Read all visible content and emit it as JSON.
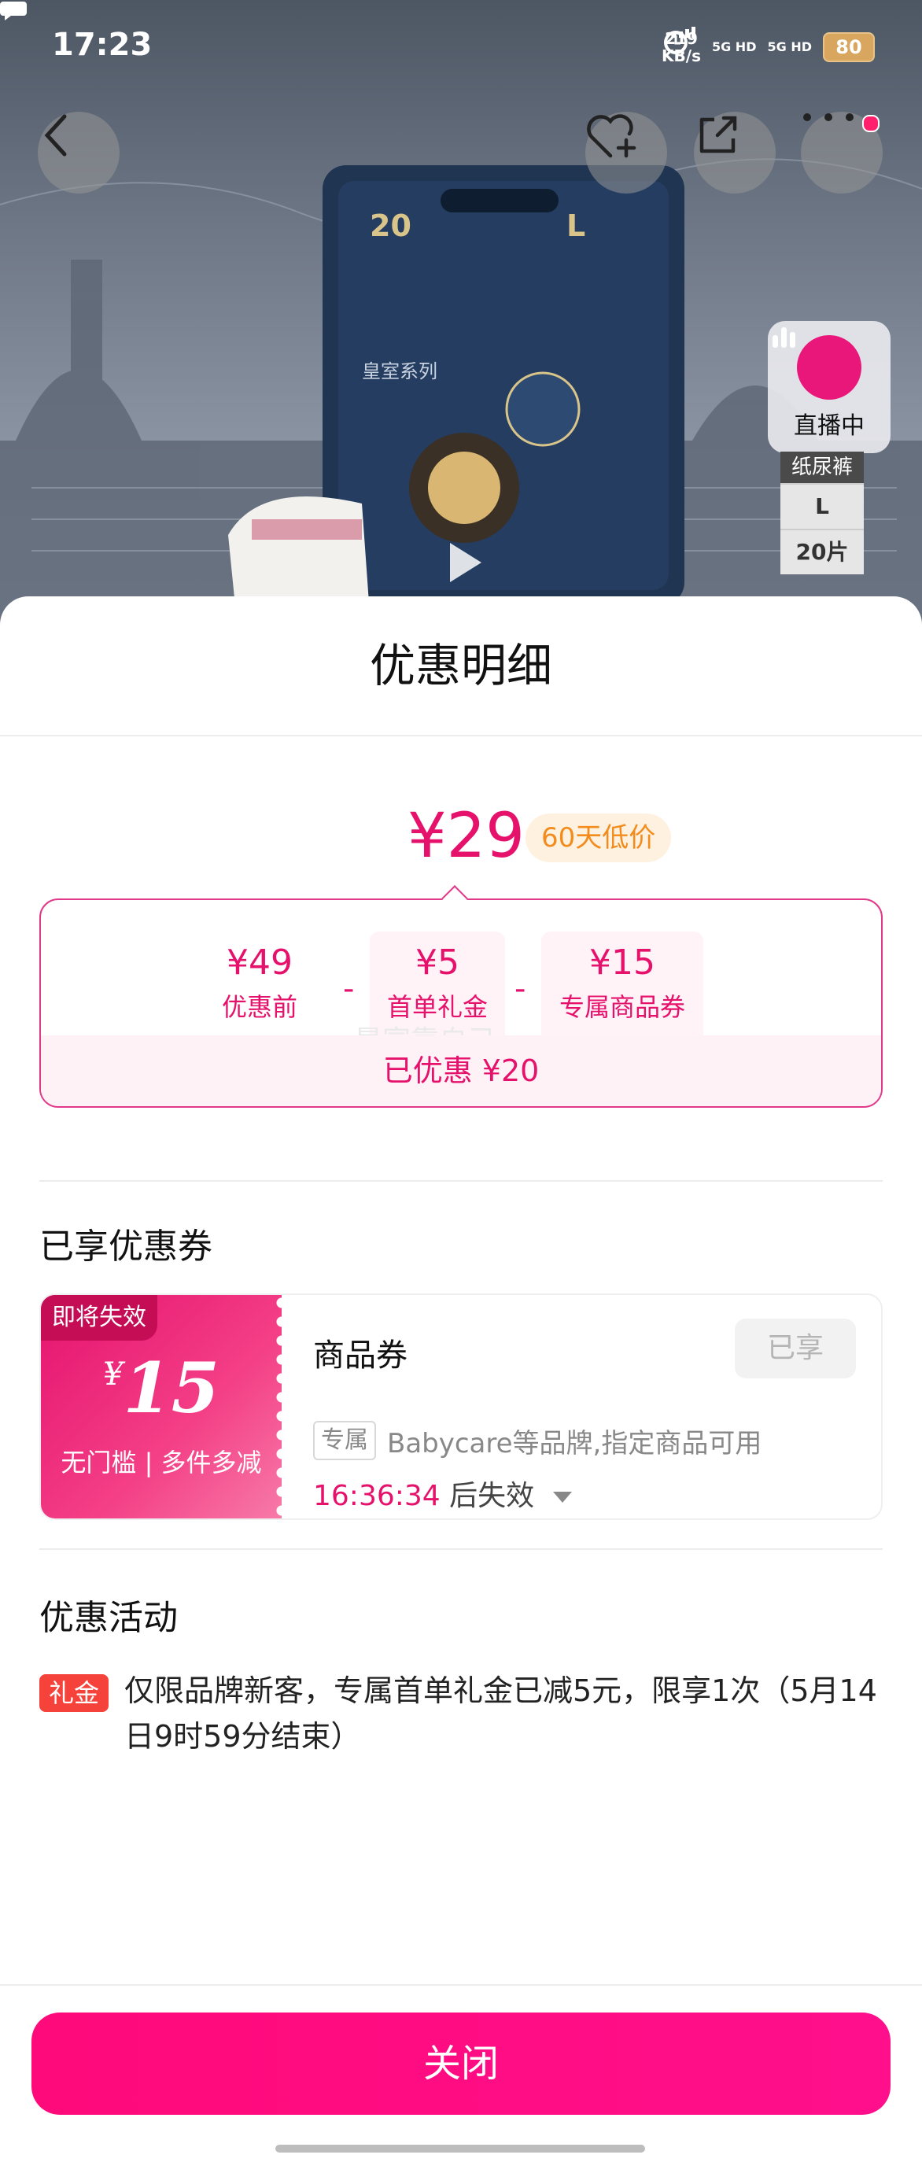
{
  "status_bar": {
    "time": "17:23",
    "net_speed_value": "219",
    "net_speed_unit": "KB/s",
    "network_1": "5G HD",
    "network_2": "5G HD",
    "battery": "80"
  },
  "product_overlay": {
    "live_label": "直播中",
    "spec_title": "纸尿裤",
    "spec_size": "L",
    "spec_count": "20片"
  },
  "sheet": {
    "title": "优惠明细",
    "final_price": "¥29",
    "low_price_badge": "60天低价",
    "breakdown": [
      {
        "value": "¥49",
        "label": "优惠前"
      },
      {
        "value": "¥5",
        "label": "首单礼金"
      },
      {
        "value": "¥15",
        "label": "专属商品券"
      }
    ],
    "operators": [
      "-",
      "-"
    ],
    "watermark": "暴富靠自己",
    "total_saved": "已优惠 ¥20"
  },
  "coupon_section": {
    "title": "已享优惠券",
    "coupon": {
      "expire_tag": "即将失效",
      "currency": "¥",
      "amount": "15",
      "condition": "无门槛 | 多件多减",
      "name": "商品券",
      "status_button": "已享",
      "exclusive_tag": "专属",
      "description": "Babycare等品牌,指定商品可用",
      "timer": "16:36:34",
      "timer_suffix": "后失效"
    }
  },
  "activity_section": {
    "title": "优惠活动",
    "tag": "礼金",
    "text": "仅限品牌新客，专属首单礼金已减5元，限享1次（5月14日9时59分结束）"
  },
  "footer": {
    "close_label": "关闭"
  },
  "colors": {
    "accent": "#e6116b",
    "button": "#ff0a7a",
    "badge_bg": "#fff1e0",
    "badge_text": "#f28c1c",
    "tag_red": "#f5433b"
  }
}
